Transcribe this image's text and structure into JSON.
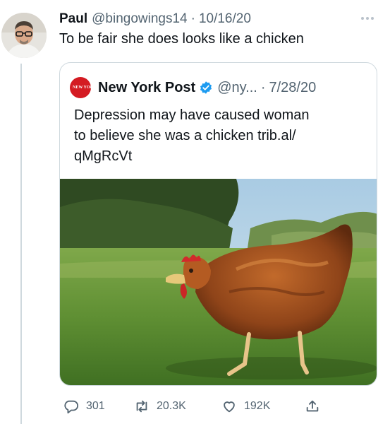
{
  "author": {
    "name": "Paul",
    "handle": "@bingowings14",
    "separator": "·",
    "date": "10/16/20",
    "text": "To be fair she does looks like a chicken"
  },
  "quote": {
    "avatar_text": "NEW YORK POST",
    "name": "New York Post",
    "handle": "@ny...",
    "separator": "·",
    "date": "7/28/20",
    "text_lines": [
      "Depression may have caused woman",
      "to believe she was a chicken trib.al/",
      "qMgRcVt"
    ],
    "image_icon": "chicken-photo"
  },
  "actions": {
    "reply_count": "301",
    "retweet_count": "20.3K",
    "like_count": "192K"
  },
  "colors": {
    "text": "#0f1419",
    "secondary": "#536471",
    "border": "#cfd9de",
    "verified": "#1d9bf0",
    "nypost_red": "#d41b22"
  },
  "icons": [
    "more-icon",
    "verified-icon",
    "reply-icon",
    "retweet-icon",
    "like-icon",
    "share-icon"
  ]
}
